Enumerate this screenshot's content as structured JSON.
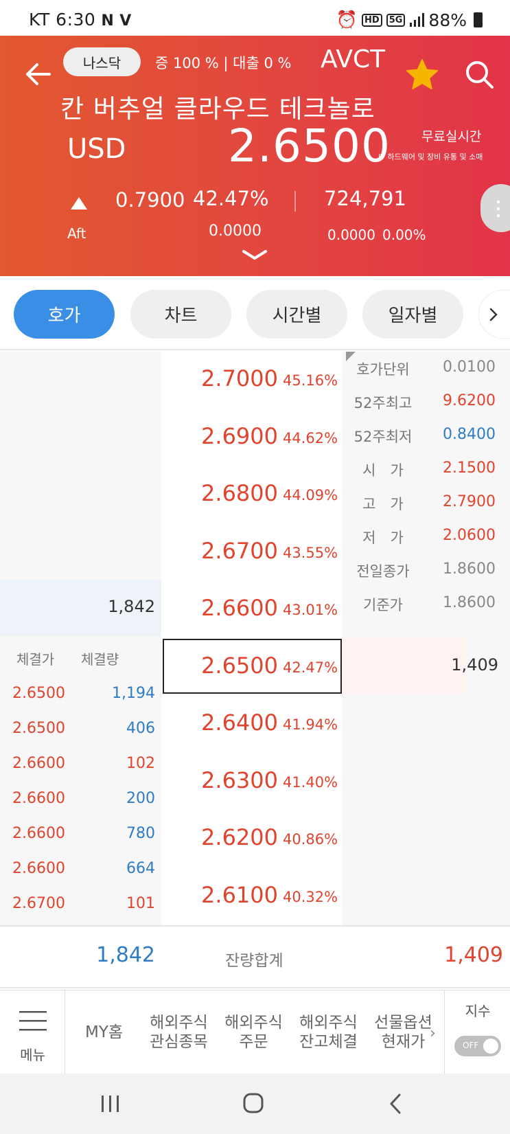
{
  "status_bar": {
    "carrier_time": "KT 6:30",
    "battery": "88%"
  },
  "header": {
    "market": "나스닥",
    "margin_info": "증 100 % | 대출 0 %",
    "ticker": "AVCT",
    "name": "칸 버추얼 클라우드 테크놀로",
    "currency": "USD",
    "price": "2.6500",
    "free_realtime": "무료실시간",
    "sector": "IT 하드웨어 및 장비 유통 및 소매",
    "change": "0.7900",
    "change_pct": "42.47%",
    "volume": "724,791",
    "aft_label": "Aft",
    "aft_price": "0.0000",
    "aft_change": "0.0000",
    "aft_change_pct": "0.00%",
    "colors": {
      "gradient_start": "#e2582f",
      "gradient_end": "#e23448",
      "star": "#f7b500"
    }
  },
  "tabs": [
    {
      "label": "호가",
      "active": true
    },
    {
      "label": "차트",
      "active": false
    },
    {
      "label": "시간별",
      "active": false
    },
    {
      "label": "일자별",
      "active": false
    }
  ],
  "order_book": {
    "levels": [
      {
        "price": "2.7000",
        "pct": "45.16%"
      },
      {
        "price": "2.6900",
        "pct": "44.62%"
      },
      {
        "price": "2.6800",
        "pct": "44.09%"
      },
      {
        "price": "2.6700",
        "pct": "43.55%"
      },
      {
        "price": "2.6600",
        "pct": "43.01%"
      },
      {
        "price": "2.6500",
        "pct": "42.47%"
      },
      {
        "price": "2.6400",
        "pct": "41.94%"
      },
      {
        "price": "2.6300",
        "pct": "41.40%"
      },
      {
        "price": "2.6200",
        "pct": "40.86%"
      },
      {
        "price": "2.6100",
        "pct": "40.32%"
      }
    ],
    "bid_qty": "1,842",
    "ask_qty": "1,409",
    "info": [
      {
        "label": "호가단위",
        "value": "0.0100",
        "color": "gray"
      },
      {
        "label": "52주최고",
        "value": "9.6200",
        "color": "red"
      },
      {
        "label": "52주최저",
        "value": "0.8400",
        "color": "blue"
      },
      {
        "label": "시　가",
        "value": "2.1500",
        "color": "red"
      },
      {
        "label": "고　가",
        "value": "2.7900",
        "color": "red"
      },
      {
        "label": "저　가",
        "value": "2.0600",
        "color": "red"
      },
      {
        "label": "전일종가",
        "value": "1.8600",
        "color": "gray"
      },
      {
        "label": "기준가",
        "value": "1.8600",
        "color": "gray"
      }
    ],
    "trades_header": {
      "price": "체결가",
      "qty": "체결량"
    },
    "trades": [
      {
        "price": "2.6500",
        "qty": "1,194",
        "side": "buy"
      },
      {
        "price": "2.6500",
        "qty": "406",
        "side": "buy"
      },
      {
        "price": "2.6600",
        "qty": "102",
        "side": "sell"
      },
      {
        "price": "2.6600",
        "qty": "200",
        "side": "buy"
      },
      {
        "price": "2.6600",
        "qty": "780",
        "side": "buy"
      },
      {
        "price": "2.6600",
        "qty": "664",
        "side": "buy"
      },
      {
        "price": "2.6700",
        "qty": "101",
        "side": "sell"
      }
    ]
  },
  "summary": {
    "bid_total": "1,842",
    "label": "잔량합계",
    "ask_total": "1,409"
  },
  "bottom_menu": {
    "menu_label": "메뉴",
    "items": [
      {
        "label": "MY홈"
      },
      {
        "label": "해외주식\n관심종목"
      },
      {
        "label": "해외주식\n주문"
      },
      {
        "label": "해외주식\n잔고체결"
      },
      {
        "label": "선물옵션\n현재가"
      }
    ],
    "index_label": "지수",
    "toggle_state": "OFF"
  }
}
